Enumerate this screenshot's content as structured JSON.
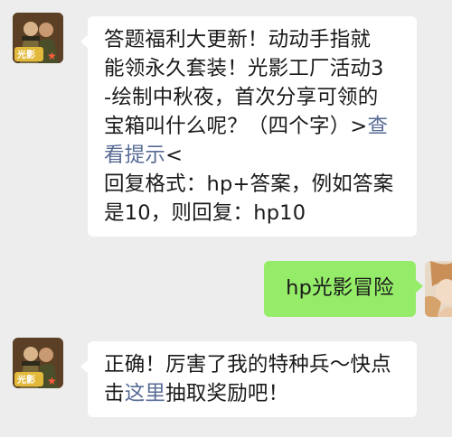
{
  "messages": [
    {
      "sender": "game-account",
      "avatar_icon": "game-logo-icon",
      "text_line1": "答题福利大更新！动动手指就",
      "text_line2": "能领永久套装！光影工厂活动3",
      "text_line3": "-绘制中秋夜，首次分享可领的",
      "text_line4_prefix": "宝箱叫什么呢？（四个字）>",
      "text_line4_link": "查",
      "text_line5_link": "看提示",
      "text_line5_suffix": "<",
      "text_line6": "回复格式：hp+答案，例如答案",
      "text_line7": "是10，则回复：hp10"
    },
    {
      "sender": "me",
      "avatar_icon": "user-avatar-icon",
      "text": "hp光影冒险"
    },
    {
      "sender": "game-account",
      "avatar_icon": "game-logo-icon",
      "text_line1": "正确！厉害了我的特种兵～快点",
      "text_line2_prefix": "击",
      "text_line2_link": "这里",
      "text_line2_suffix": "抽取奖励吧！"
    }
  ],
  "colors": {
    "background": "#ededed",
    "incoming_bubble": "#ffffff",
    "outgoing_bubble": "#95ec69",
    "link": "#576b95"
  }
}
